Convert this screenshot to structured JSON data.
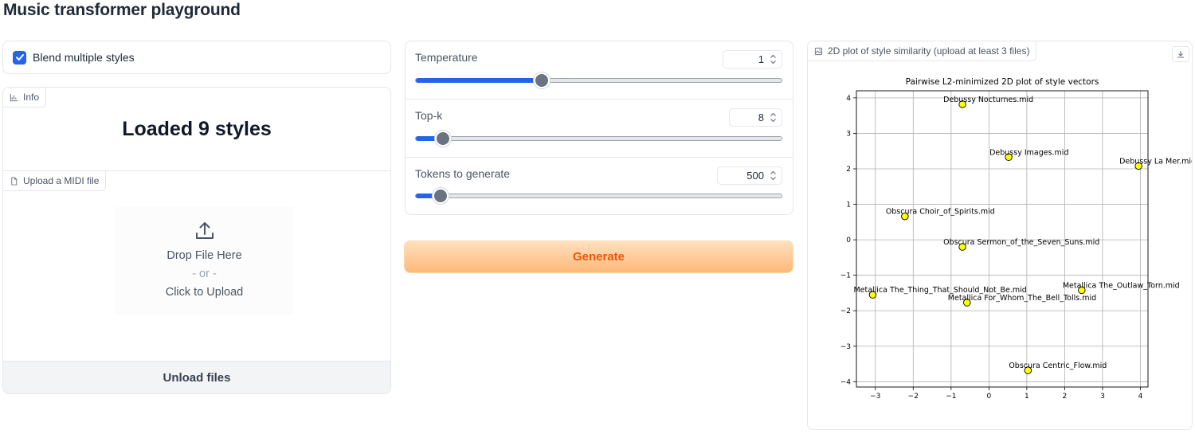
{
  "page": {
    "title": "Music transformer playground"
  },
  "blend": {
    "label": "Blend multiple styles",
    "checked": true,
    "accent_color": "#2563eb"
  },
  "info": {
    "chip_label": "Info",
    "icon": "bar-chart-icon",
    "text": "Loaded 9 styles"
  },
  "upload": {
    "chip_label": "Upload a MIDI file",
    "icon": "file-icon",
    "drop_text": "Drop File Here",
    "or_text": "- or -",
    "click_text": "Click to Upload",
    "unload_label": "Unload files"
  },
  "sliders": [
    {
      "label": "Temperature",
      "value": "1",
      "fraction": 0.342
    },
    {
      "label": "Top-k",
      "value": "8",
      "fraction": 0.074
    },
    {
      "label": "Tokens to generate",
      "value": "500",
      "fraction": 0.067
    }
  ],
  "generate": {
    "label": "Generate",
    "text_color": "#ea580c"
  },
  "plot": {
    "chip_label": "2D plot of style similarity (upload at least 3 files)",
    "icon": "image-icon",
    "download_icon": "download-icon"
  },
  "chart_data": {
    "type": "scatter",
    "title": "Pairwise L2-minimized 2D plot of style vectors",
    "xlabel": "",
    "ylabel": "",
    "xlim": [
      -3.5,
      4.2
    ],
    "ylim": [
      -4.15,
      4.2
    ],
    "xticks": [
      -3,
      -2,
      -1,
      0,
      1,
      2,
      3,
      4
    ],
    "yticks": [
      4,
      3,
      2,
      1,
      0,
      -1,
      -2,
      -3,
      -4
    ],
    "xtick_labels": [
      "−3",
      "−2",
      "−1",
      "0",
      "1",
      "2",
      "3",
      "4"
    ],
    "ytick_labels": [
      "4",
      "3",
      "2",
      "1",
      "0",
      "−1",
      "−2",
      "−3",
      "−4"
    ],
    "grid": true,
    "point_color": "#ffff00",
    "points": [
      {
        "label": "Debussy Nocturnes.mid",
        "x": -0.7,
        "y": 3.82
      },
      {
        "label": "Debussy Images.mid",
        "x": 0.52,
        "y": 2.33
      },
      {
        "label": "Debussy La Mer.mid",
        "x": 3.95,
        "y": 2.08
      },
      {
        "label": "Obscura Choir_of_Spirits.mid",
        "x": -2.22,
        "y": 0.66
      },
      {
        "label": "Obscura Sermon_of_the_Seven_Suns.mid",
        "x": -0.7,
        "y": -0.2
      },
      {
        "label": "Metallica The_Thing_That_Should_Not_Be.mid",
        "x": -3.07,
        "y": -1.55
      },
      {
        "label": "Metallica For_Whom_The_Bell_Tolls.mid",
        "x": -0.58,
        "y": -1.77
      },
      {
        "label": "Metallica The_Outlaw_Torn.mid",
        "x": 2.45,
        "y": -1.42
      },
      {
        "label": "Obscura Centric_Flow.mid",
        "x": 1.03,
        "y": -3.68
      }
    ]
  }
}
